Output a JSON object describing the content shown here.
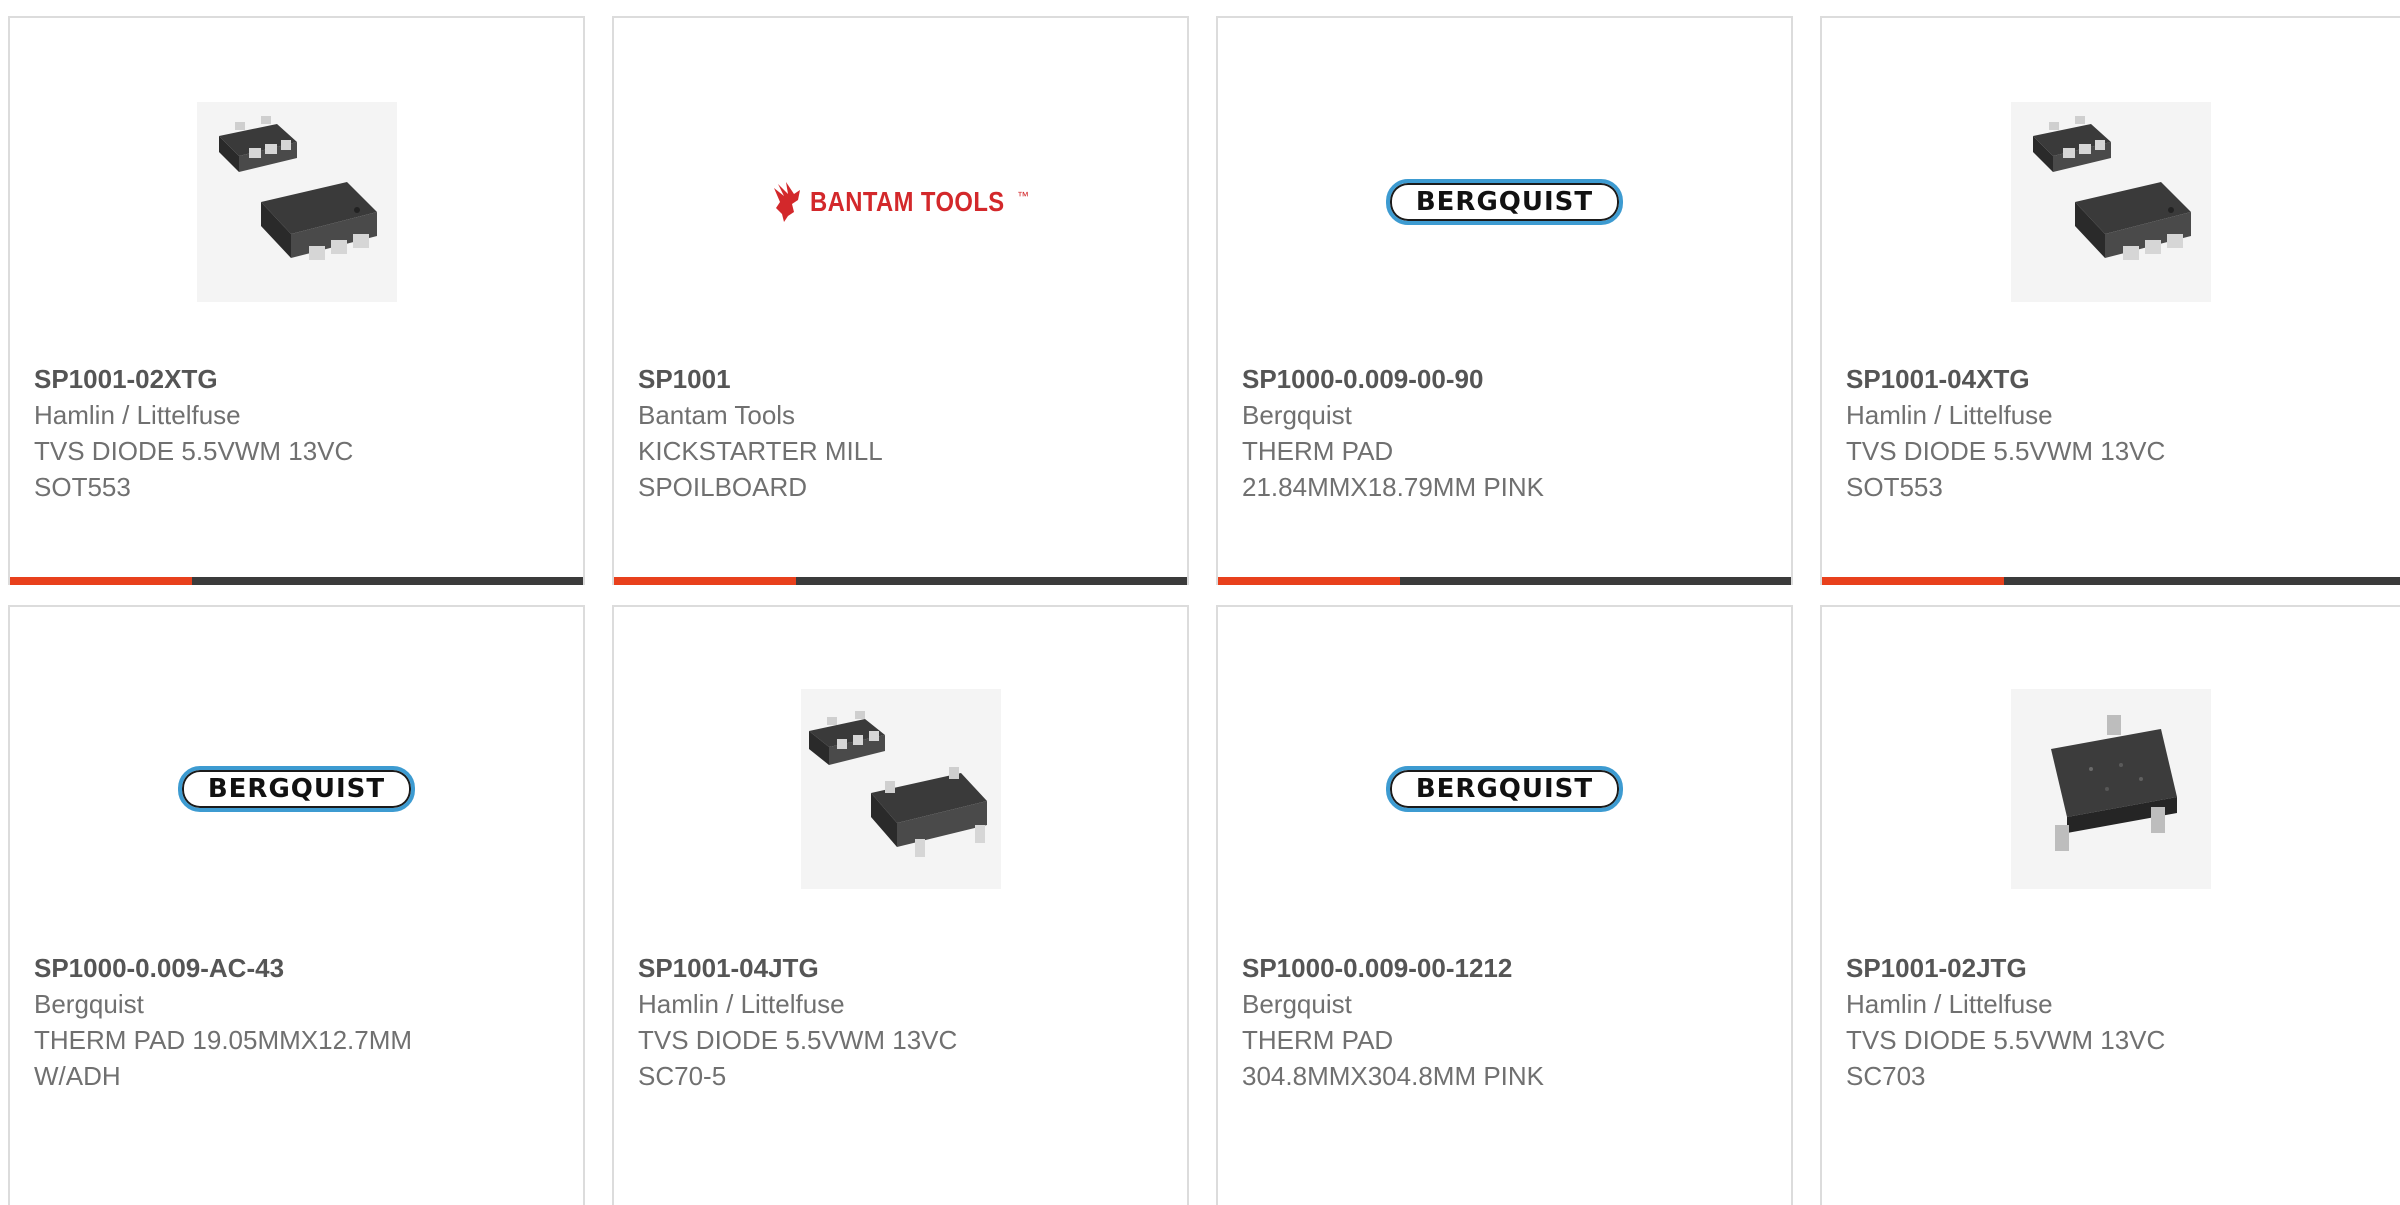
{
  "products": [
    {
      "part_number": "SP1001-02XTG",
      "manufacturer": "Hamlin / Littelfuse",
      "desc1": "TVS DIODE 5.5VWM 13VC",
      "desc2": "SOT553",
      "image": "sot553-package-photo"
    },
    {
      "part_number": "SP1001",
      "manufacturer": "Bantam Tools",
      "desc1": "KICKSTARTER MILL",
      "desc2": "SPOILBOARD",
      "image": "bantam-tools-logo",
      "logo_text": "BANTAM TOOLS",
      "logo_tm": "™"
    },
    {
      "part_number": "SP1000-0.009-00-90",
      "manufacturer": "Bergquist",
      "desc1": "THERM PAD",
      "desc2": "21.84MMX18.79MM PINK",
      "image": "bergquist-logo",
      "logo_text": "BERGQUIST"
    },
    {
      "part_number": "SP1001-04XTG",
      "manufacturer": "Hamlin / Littelfuse",
      "desc1": "TVS DIODE 5.5VWM 13VC",
      "desc2": "SOT553",
      "image": "sot553-package-photo"
    },
    {
      "part_number": "SP1000-0.009-AC-43",
      "manufacturer": "Bergquist",
      "desc1": "THERM PAD 19.05MMX12.7MM",
      "desc2": "W/ADH",
      "image": "bergquist-logo",
      "logo_text": "BERGQUIST"
    },
    {
      "part_number": "SP1001-04JTG",
      "manufacturer": "Hamlin / Littelfuse",
      "desc1": "TVS DIODE 5.5VWM 13VC",
      "desc2": "SC70-5",
      "image": "sc70-package-photo"
    },
    {
      "part_number": "SP1000-0.009-00-1212",
      "manufacturer": "Bergquist",
      "desc1": "THERM PAD",
      "desc2": "304.8MMX304.8MM PINK",
      "image": "bergquist-logo",
      "logo_text": "BERGQUIST"
    },
    {
      "part_number": "SP1001-02JTG",
      "manufacturer": "Hamlin / Littelfuse",
      "desc1": "TVS DIODE 5.5VWM 13VC",
      "desc2": "SC703",
      "image": "sc70-3-package-photo"
    }
  ],
  "colors": {
    "accent": "#e8401c",
    "bar": "#3b3b3b",
    "text": "#707070",
    "bergquist_ring": "#3d9bd1",
    "bantam_red": "#d3282b"
  }
}
